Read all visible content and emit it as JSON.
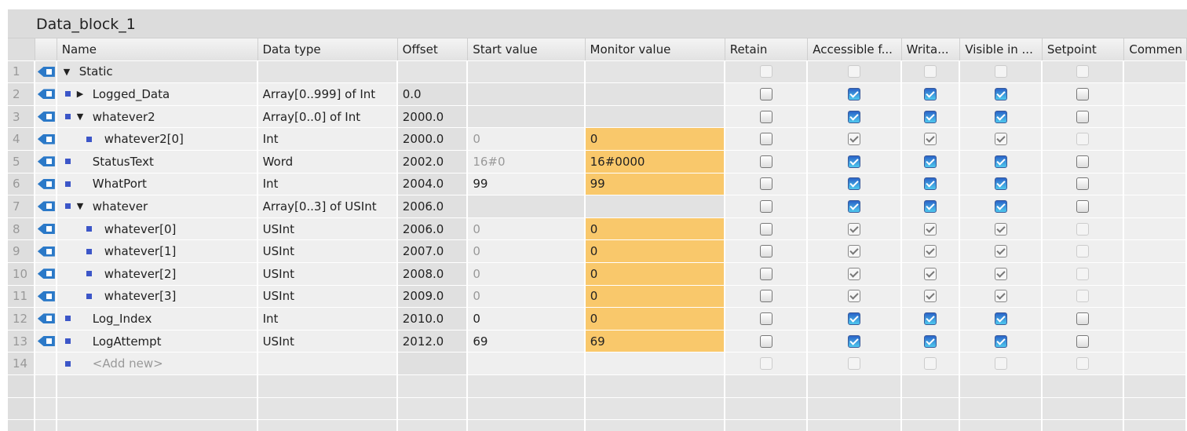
{
  "title": "Data_block_1",
  "columns": [
    "",
    "",
    "Name",
    "Data type",
    "Offset",
    "Start value",
    "Monitor value",
    "Retain",
    "Accessible f...",
    "Writa...",
    "Visible in ...",
    "Setpoint",
    "Commen"
  ],
  "rows": [
    {
      "num": "1",
      "level": 0,
      "expand": "down",
      "bullet": false,
      "name": "Static",
      "type": "",
      "offset": "",
      "start": "",
      "monitor": "",
      "checks": [
        "disabled",
        "disabled",
        "disabled",
        "disabled",
        "disabled"
      ]
    },
    {
      "num": "2",
      "level": 1,
      "expand": "right",
      "bullet": true,
      "name": "Logged_Data",
      "type": "Array[0..999] of Int",
      "offset": "0.0",
      "start": "",
      "monitor": "",
      "checks": [
        "off",
        "on",
        "on",
        "on",
        "off"
      ]
    },
    {
      "num": "3",
      "level": 1,
      "expand": "down",
      "bullet": true,
      "name": "whatever2",
      "type": "Array[0..0] of Int",
      "offset": "2000.0",
      "start": "",
      "monitor": "",
      "checks": [
        "off",
        "on",
        "on",
        "on",
        "off"
      ]
    },
    {
      "num": "4",
      "level": 2,
      "expand": "",
      "bullet": true,
      "name": "whatever2[0]",
      "type": "Int",
      "offset": "2000.0",
      "start": "0",
      "startDim": true,
      "monitor": "0",
      "checks": [
        "off",
        "grey",
        "grey",
        "grey",
        "disabled"
      ]
    },
    {
      "num": "5",
      "level": 1,
      "expand": "",
      "bullet": true,
      "name": "StatusText",
      "type": "Word",
      "offset": "2002.0",
      "start": "16#0",
      "startDim": true,
      "monitor": "16#0000",
      "checks": [
        "off",
        "on",
        "on",
        "on",
        "off"
      ]
    },
    {
      "num": "6",
      "level": 1,
      "expand": "",
      "bullet": true,
      "name": "WhatPort",
      "type": "Int",
      "offset": "2004.0",
      "start": "99",
      "monitor": "99",
      "checks": [
        "off",
        "on",
        "on",
        "on",
        "off"
      ]
    },
    {
      "num": "7",
      "level": 1,
      "expand": "down",
      "bullet": true,
      "name": "whatever",
      "type": "Array[0..3] of USInt",
      "offset": "2006.0",
      "start": "",
      "monitor": "",
      "checks": [
        "off",
        "on",
        "on",
        "on",
        "off"
      ]
    },
    {
      "num": "8",
      "level": 2,
      "expand": "",
      "bullet": true,
      "name": "whatever[0]",
      "type": "USInt",
      "offset": "2006.0",
      "start": "0",
      "startDim": true,
      "monitor": "0",
      "checks": [
        "off",
        "grey",
        "grey",
        "grey",
        "disabled"
      ]
    },
    {
      "num": "9",
      "level": 2,
      "expand": "",
      "bullet": true,
      "name": "whatever[1]",
      "type": "USInt",
      "offset": "2007.0",
      "start": "0",
      "startDim": true,
      "monitor": "0",
      "checks": [
        "off",
        "grey",
        "grey",
        "grey",
        "disabled"
      ]
    },
    {
      "num": "10",
      "level": 2,
      "expand": "",
      "bullet": true,
      "name": "whatever[2]",
      "type": "USInt",
      "offset": "2008.0",
      "start": "0",
      "startDim": true,
      "monitor": "0",
      "checks": [
        "off",
        "grey",
        "grey",
        "grey",
        "disabled"
      ]
    },
    {
      "num": "11",
      "level": 2,
      "expand": "",
      "bullet": true,
      "name": "whatever[3]",
      "type": "USInt",
      "offset": "2009.0",
      "start": "0",
      "startDim": true,
      "monitor": "0",
      "checks": [
        "off",
        "grey",
        "grey",
        "grey",
        "disabled"
      ]
    },
    {
      "num": "12",
      "level": 1,
      "expand": "",
      "bullet": true,
      "name": "Log_Index",
      "type": "Int",
      "offset": "2010.0",
      "start": "0",
      "monitor": "0",
      "checks": [
        "off",
        "on",
        "on",
        "on",
        "off"
      ]
    },
    {
      "num": "13",
      "level": 1,
      "expand": "",
      "bullet": true,
      "name": "LogAttempt",
      "type": "USInt",
      "offset": "2012.0",
      "start": "69",
      "monitor": "69",
      "checks": [
        "off",
        "on",
        "on",
        "on",
        "off"
      ]
    },
    {
      "num": "14",
      "level": 1,
      "expand": "",
      "bullet": true,
      "noicon": true,
      "name": "<Add new>",
      "addnew": true,
      "type": "",
      "offset": "",
      "start": "",
      "monitor": "",
      "checks": [
        "disabled",
        "disabled",
        "disabled",
        "disabled",
        "disabled"
      ]
    }
  ]
}
